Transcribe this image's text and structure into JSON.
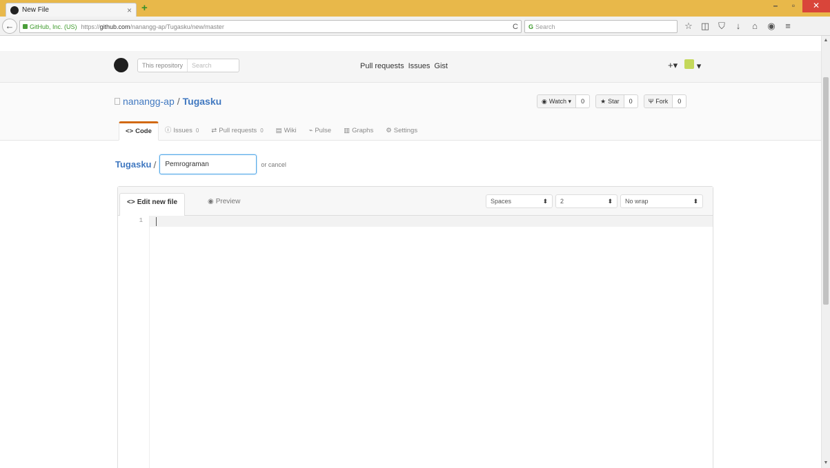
{
  "browser": {
    "tab_title": "New File",
    "tab_close": "×",
    "new_tab": "+",
    "window": {
      "minimize": "–",
      "maximize": "▫",
      "close": "✕"
    },
    "back": "←",
    "lock_org": "GitHub, Inc. (US)",
    "url_prefix": "https://",
    "url_host": "github.com",
    "url_path": "/nanangg-ap/Tugasku/new/master",
    "reload": "C",
    "search_placeholder": "Search",
    "toolbar_icons": [
      "☆",
      "◫",
      "⛉",
      "↓",
      "⌂",
      "◉",
      "≡"
    ]
  },
  "github": {
    "search_scope": "This repository",
    "search_placeholder": "Search",
    "nav": [
      "Pull requests",
      "Issues",
      "Gist"
    ],
    "create": "+▾"
  },
  "repo": {
    "owner": "nanangg-ap",
    "sep": "/",
    "name": "Tugasku",
    "watch": {
      "label": "Watch ▾",
      "count": "0"
    },
    "star": {
      "label": "Star",
      "count": "0"
    },
    "fork": {
      "label": "Fork",
      "count": "0"
    },
    "tabs": [
      {
        "label": "Code",
        "icon": "<>",
        "badge": ""
      },
      {
        "label": "Issues",
        "icon": "ⓘ",
        "badge": "0"
      },
      {
        "label": "Pull requests",
        "icon": "⇄",
        "badge": "0"
      },
      {
        "label": "Wiki",
        "icon": "▤",
        "badge": ""
      },
      {
        "label": "Pulse",
        "icon": "⌁",
        "badge": ""
      },
      {
        "label": "Graphs",
        "icon": "▥",
        "badge": ""
      },
      {
        "label": "Settings",
        "icon": "⚙",
        "badge": ""
      }
    ]
  },
  "newfile": {
    "root": "Tugasku",
    "sep": "/",
    "filename": "Pemrograman",
    "cancel": "or cancel"
  },
  "editor": {
    "tab_edit": "Edit new file",
    "tab_edit_icon": "<>",
    "tab_preview": "Preview",
    "tab_preview_icon": "◉",
    "indent_mode": "Spaces",
    "indent_size": "2",
    "wrap_mode": "No wrap",
    "line_number": "1"
  }
}
